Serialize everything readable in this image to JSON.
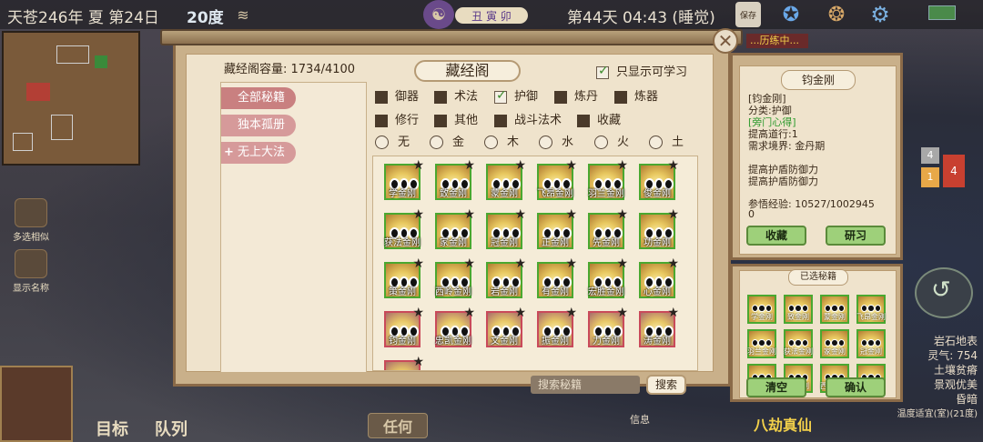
{
  "status_bar": {
    "date": "天苍246年 夏 第24日",
    "temperature": "20度",
    "time_label": "丑 寅 卯",
    "day_time": "第44天 04:43 (睡觉)",
    "save_label": "保存"
  },
  "left_buttons": {
    "multi_select": "多选相似",
    "show_names": "显示名称"
  },
  "bottom": {
    "target": "目标",
    "team": "队列",
    "any_select": "任何",
    "info": "信息",
    "rank": "八劫真仙"
  },
  "notice": "...历练中...",
  "badges": [
    "4",
    "1",
    "4"
  ],
  "right_info": [
    "岩石地表",
    "灵气: 754",
    "土壤贫瘠",
    "景观优美",
    "昏暗",
    "温度适宜(室)(21度)"
  ],
  "dialog": {
    "capacity": "藏经阁容量:   1734/4100",
    "title": "藏经阁",
    "only_learnable": "只显示可学习",
    "tabs": [
      {
        "label": "全部秘籍"
      },
      {
        "label": "独本孤册"
      },
      {
        "label": "无上大法"
      }
    ],
    "filters_row1": [
      {
        "label": "御器",
        "checked": false
      },
      {
        "label": "术法",
        "checked": false
      },
      {
        "label": "护御",
        "checked": true
      },
      {
        "label": "炼丹",
        "checked": false
      },
      {
        "label": "炼器",
        "checked": false
      }
    ],
    "filters_row2": [
      {
        "label": "修行",
        "checked": false
      },
      {
        "label": "其他",
        "checked": false
      },
      {
        "label": "战斗法术",
        "checked": false
      },
      {
        "label": "收藏",
        "checked": false
      }
    ],
    "elements": [
      "无",
      "金",
      "木",
      "水",
      "火",
      "土"
    ],
    "books": [
      "学金刚",
      "致金刚",
      "蒙金刚",
      "飞昂金刚",
      "羽兰金刚",
      "俊金刚",
      "获法金刚",
      "家金刚",
      "冠金刚",
      "正金刚",
      "先金刚",
      "功金刚",
      "策金刚",
      "西岭金刚",
      "岩金刚",
      "有金刚",
      "宏胜金刚",
      "心金刚",
      "钧金刚",
      "忠凯金刚",
      "文金刚",
      "振金刚",
      "力金刚",
      "涛金刚",
      ""
    ],
    "search_placeholder": "搜索秘籍",
    "search_button": "搜索"
  },
  "detail": {
    "title": "钧金刚",
    "name": "[钧金刚]",
    "category": "分类:护御",
    "school": "[旁门心得]",
    "boost": "提高道行:1",
    "realm": "需求境界:  金丹期",
    "effect1": "提高护盾防御力",
    "effect2": "提高护盾防御力",
    "exp_label": "参悟经验:  10527/1002945",
    "exp_tail": "0",
    "collect_button": "收藏",
    "study_button": "研习"
  },
  "selected": {
    "title": "已选秘籍",
    "books": [
      "学金刚",
      "致金刚",
      "蒙金刚",
      "飞昂金刚",
      "羽兰金刚",
      "获法金刚",
      "家金刚",
      "冠金刚",
      "获法金刚",
      "先金刚",
      "西岭金刚",
      "策金刚"
    ],
    "clear_button": "清空",
    "confirm_button": "确认"
  }
}
